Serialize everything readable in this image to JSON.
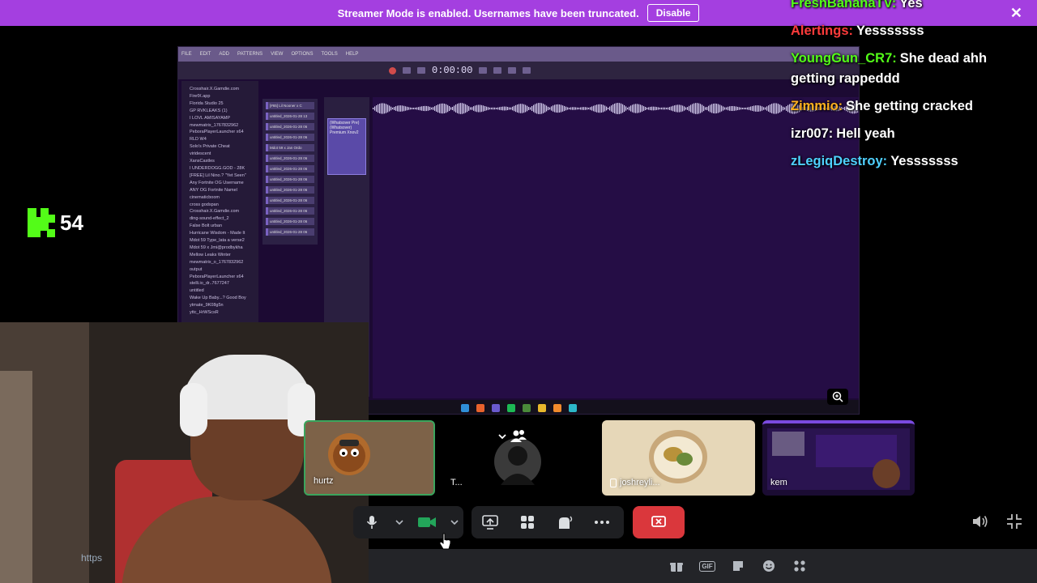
{
  "banner": {
    "text": "Streamer Mode is enabled. Usernames have been truncated.",
    "disable_label": "Disable",
    "close_symbol": "✕",
    "color": "#a43fe0"
  },
  "chat": [
    {
      "user": "FreshBananaTV:",
      "message": "Yes",
      "color": "#53fc18"
    },
    {
      "user": "Alertings:",
      "message": "Yesssssss",
      "color": "#ff3b3b"
    },
    {
      "user": "YoungGun_CR7:",
      "message": "She dead ahh getting rappeddd",
      "color": "#53fc18"
    },
    {
      "user": "Zimmio:",
      "message": "She getting cracked",
      "color": "#ffb020"
    },
    {
      "user": "izr007:",
      "message": "Hell yeah",
      "color": "#ffffff"
    },
    {
      "user": "zLegiqDestroy:",
      "message": "Yesssssss",
      "color": "#4fd1ff"
    }
  ],
  "kick": {
    "count": "54",
    "color": "#53fc18"
  },
  "screen": {
    "time": "0:00:00",
    "menu": [
      "FILE",
      "EDIT",
      "ADD",
      "PATTERNS",
      "VIEW",
      "OPTIONS",
      "TOOLS",
      "HELP"
    ],
    "browser_items": [
      "Crosshair.X.Gamdie.com",
      "FirefX.app",
      "Florida Studio 25",
      "GP RVKLEAKS (1)",
      "I LOVL AMISAYAMP",
      "mewmatrix_1767832962",
      "PeboraPlayerLauncher x64",
      "RLD W4",
      "Solo's Private Cheat",
      "viridescent",
      "XansCastles",
      "I UNDERDOGG.GOD - 28K",
      "[FREE] Lil Nino.? \"Yet Seen\"",
      "Any Fortnite OG Username",
      "ANY OG Fortnite Namel",
      "cinematicboom",
      "cross godspan",
      "Crosshair.X.Gamdie.com",
      "ding-sound-effect_2",
      "False Bolt urban",
      "Hurricane Wisdom - Made It",
      "Mdot 59 Type_lata a verse2",
      "Mdot 59 x Jmi@prodbykha",
      "Mellow Leaks Winter",
      "mewmatrix_o_1767832962",
      "output",
      "PeboraPlayerLauncher x64",
      "stelli.io_dr..7677247",
      "untitled",
      "Wake Up Baby...? Good Boy",
      "ytmate_9K08g5n",
      "yttc_HrWScsR"
    ],
    "channels": [
      "[#65] Lil Nooner x C",
      "untitled_2026-01-28 13",
      "untitled_2026-01-28 06",
      "untitled_2026-01-28 06",
      "Mdot 59 x Jan Ordo",
      "untitled_2026-01-28 06",
      "untitled_2026-01-28 06",
      "untitled_2026-01-28 06",
      "untitled_2026-01-28 06",
      "untitled_2026-01-28 06",
      "untitled_2026-01-28 06",
      "untitled_2026-01-28 06",
      "untitled_2026-01-28 06"
    ],
    "pattern_clip": "(Whatsover Pre) (Whatsover) Premium Xnov2"
  },
  "participants": [
    {
      "name": "hurtz",
      "accent": "#8a6a4a"
    },
    {
      "name": "T...",
      "accent": "#000000"
    },
    {
      "name": "joshreyli...",
      "accent": "#e6d7b8"
    },
    {
      "name": "kem",
      "accent": "#6a3fc2"
    }
  ],
  "cam": {
    "link_text": "https"
  },
  "controls": {
    "camera_color": "#23a55a",
    "end_call_color": "#da373c"
  },
  "msgbar_icons": [
    "gift-icon",
    "gif-icon",
    "sticker-icon",
    "emoji-icon",
    "apps-icon"
  ],
  "msgbar_gif_label": "GIF"
}
